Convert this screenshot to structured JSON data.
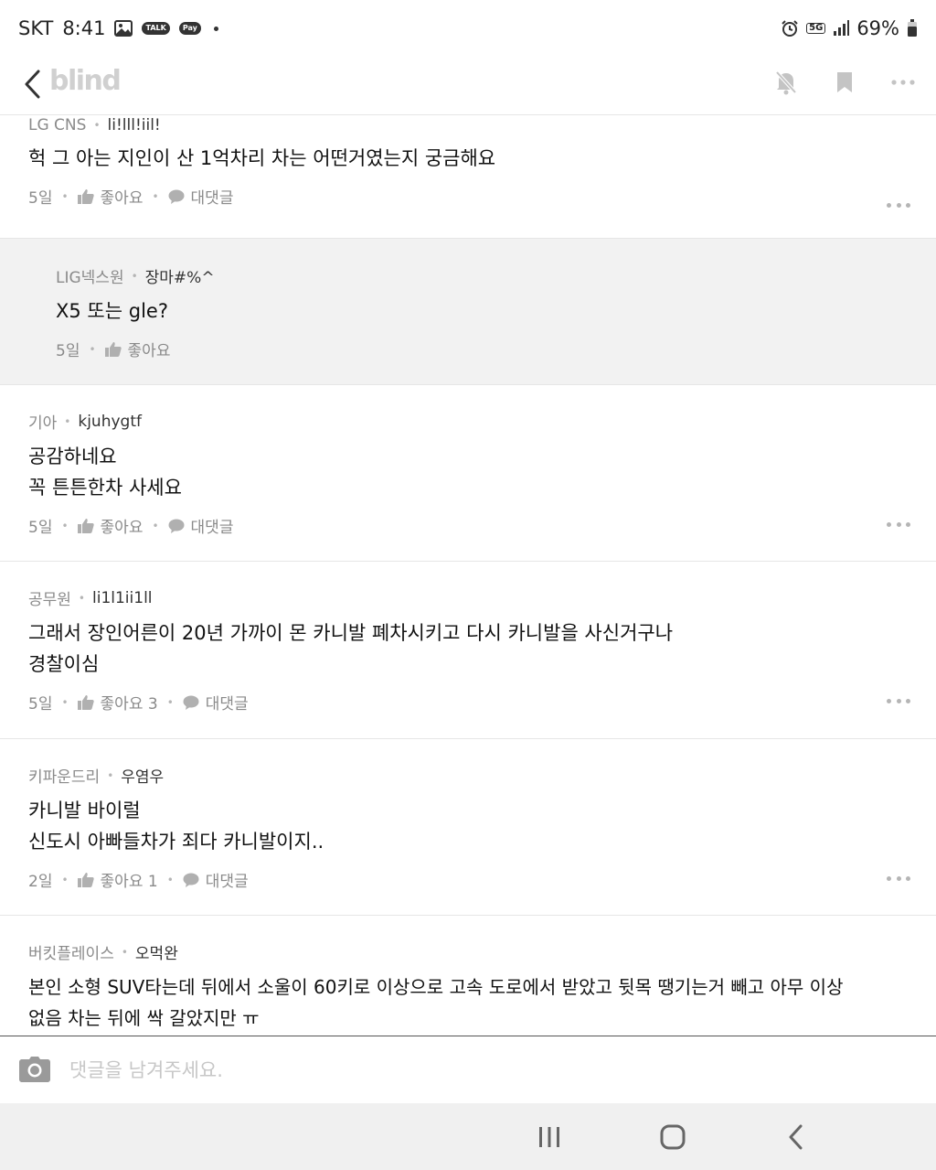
{
  "status_bar": {
    "carrier": "SKT",
    "time": "8:41",
    "talk_label": "TALK",
    "pay_label": "Pay",
    "network": "5G",
    "battery": "69%"
  },
  "app_bar": {
    "logo": "blind"
  },
  "comments": [
    {
      "company": "LG CNS",
      "nickname": "li!lll!iil!",
      "lines": [
        "헉 그 아는 지인이 산 1억차리 차는 어떤거였는지 궁금해요"
      ],
      "age": "5일",
      "like_label": "좋아요",
      "reply_label": "대댓글"
    },
    {
      "company": "LIG넥스원",
      "nickname": "장마#%^",
      "lines": [
        "X5 또는 gle?"
      ],
      "age": "5일",
      "like_label": "좋아요"
    },
    {
      "company": "기아",
      "nickname": "kjuhygtf",
      "lines": [
        "공감하네요",
        "꼭 튼튼한차 사세요"
      ],
      "age": "5일",
      "like_label": "좋아요",
      "reply_label": "대댓글"
    },
    {
      "company": "공무원",
      "nickname": "li1l1ii1ll",
      "lines": [
        "그래서 장인어른이 20년 가까이 몬 카니발 폐차시키고 다시 카니발을 사신거구나",
        "경찰이심"
      ],
      "age": "5일",
      "like_label": "좋아요 3",
      "reply_label": "대댓글"
    },
    {
      "company": "키파운드리",
      "nickname": "우염우",
      "lines": [
        "카니발 바이럴",
        "신도시 아빠들차가 죄다 카니발이지.."
      ],
      "age": "2일",
      "like_label": "좋아요 1",
      "reply_label": "대댓글"
    },
    {
      "company": "버킷플레이스",
      "nickname": "오먹완",
      "lines": [
        "본인 소형 SUV타는데 뒤에서 소울이 60키로 이상으로 고속 도로에서 받았고 뒷목 땡기는거 빼고 아무 이상",
        "없음 차는 뒤에 싹 갈았지만 ㅠ"
      ]
    }
  ],
  "input": {
    "placeholder": "댓글을 남겨주세요."
  },
  "colors": {
    "reply_background": "#f2f2f2",
    "meta_text": "#8a8a8a",
    "logo": "#d0d0d0"
  }
}
